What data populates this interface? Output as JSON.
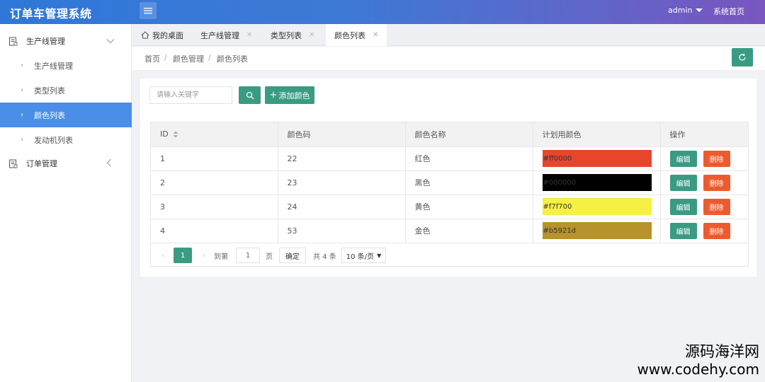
{
  "app": {
    "title": "订单车管理系统"
  },
  "header": {
    "user": "admin",
    "home_link": "系统首页"
  },
  "sidebar": {
    "groups": [
      {
        "label": "生产线管理",
        "expanded": true,
        "items": [
          {
            "label": "生产线管理",
            "active": false
          },
          {
            "label": "类型列表",
            "active": false
          },
          {
            "label": "颜色列表",
            "active": true
          },
          {
            "label": "发动机列表",
            "active": false
          }
        ]
      },
      {
        "label": "订单管理",
        "expanded": false,
        "items": []
      }
    ]
  },
  "tabs": [
    {
      "label": "我的桌面",
      "icon": "home-icon",
      "closable": false,
      "active": false
    },
    {
      "label": "生产线管理",
      "closable": true,
      "active": false
    },
    {
      "label": "类型列表",
      "closable": true,
      "active": false
    },
    {
      "label": "颜色列表",
      "closable": true,
      "active": true
    }
  ],
  "breadcrumb": [
    "首页",
    "颜色管理",
    "颜色列表"
  ],
  "toolbar": {
    "search_placeholder": "请输入关键字",
    "add_label": "添加颜色"
  },
  "table": {
    "columns": [
      "ID",
      "颜色码",
      "颜色名称",
      "计划用颜色",
      "操作"
    ],
    "rows": [
      {
        "id": "1",
        "code": "22",
        "name": "红色",
        "hex": "#ff0000",
        "swatch": "#e8452c",
        "edit": "编辑",
        "delete": "删除"
      },
      {
        "id": "2",
        "code": "23",
        "name": "黑色",
        "hex": "#000000",
        "swatch": "#000000",
        "edit": "编辑",
        "delete": "删除"
      },
      {
        "id": "3",
        "code": "24",
        "name": "黄色",
        "hex": "#f7f700",
        "swatch": "#f5f042",
        "edit": "编辑",
        "delete": "删除"
      },
      {
        "id": "4",
        "code": "53",
        "name": "金色",
        "hex": "#b5921d",
        "swatch": "#b8922a",
        "edit": "编辑",
        "delete": "删除"
      }
    ]
  },
  "pagination": {
    "current": "1",
    "goto_label": "到第",
    "goto_value": "1",
    "page_unit": "页",
    "confirm": "确定",
    "total": "共 4 条",
    "page_size": "10 条/页"
  },
  "watermark": {
    "line1": "源码海洋网",
    "line2": "www.codehy.com"
  },
  "colors": {
    "accent": "#3a9b83",
    "danger": "#ee5a2e",
    "nav_active": "#4a8ee8"
  }
}
